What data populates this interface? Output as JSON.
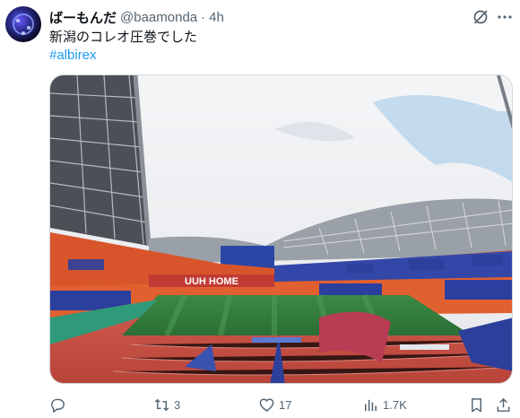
{
  "tweet": {
    "display_name": "ばーもんだ",
    "handle": "@baamonda",
    "separator": "·",
    "time": "4h",
    "text": "新潟のコレオ圧巻でした",
    "hashtag": "#albirex",
    "media": {
      "scoreboard_text": "UUH HOME",
      "icon": "stadium-photo"
    }
  },
  "actions": {
    "reply": {
      "icon": "reply-icon",
      "count": ""
    },
    "repost": {
      "icon": "repost-icon",
      "count": "3"
    },
    "like": {
      "icon": "heart-icon",
      "count": "17"
    },
    "views": {
      "icon": "views-icon",
      "count": "1.7K"
    },
    "bookmark": {
      "icon": "bookmark-icon",
      "count": ""
    },
    "share": {
      "icon": "share-icon",
      "count": ""
    }
  },
  "colors": {
    "link": "#1d9bf0",
    "muted": "#536471",
    "text": "#0f1419",
    "stand_orange": "#e05a2b",
    "stand_blue": "#2a3f9e",
    "pitch_green": "#2f7a3a",
    "track_red": "#c0463c"
  }
}
